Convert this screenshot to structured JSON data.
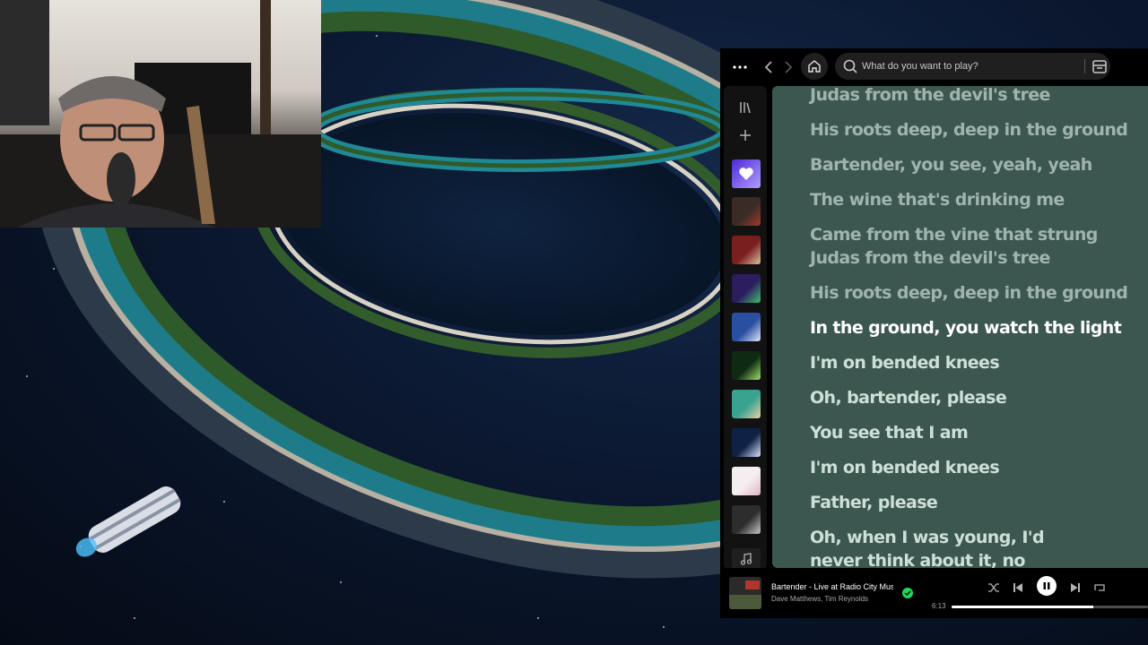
{
  "topbar": {
    "search_placeholder": "What do you want to play?",
    "icons": [
      "more-icon",
      "back-icon",
      "forward-icon",
      "home-icon",
      "search-icon",
      "browse-icon"
    ]
  },
  "sidebar": {
    "icons": [
      "library-icon",
      "plus-icon",
      "heart-icon",
      "music-note-icon"
    ],
    "tiles": [
      {
        "color": "#8a5cf6",
        "color2": "#c9a5ff"
      },
      {
        "color": "#3a2b26",
        "color2": "#a33a2a"
      },
      {
        "color": "#7a1f1f",
        "color2": "#d9c3a0"
      },
      {
        "color": "#2c1d5e",
        "color2": "#3fbf6f"
      },
      {
        "color": "#2b4fa0",
        "color2": "#e0e8f7"
      },
      {
        "color": "#0f2a12",
        "color2": "#9be36a"
      },
      {
        "color": "#3aa38f",
        "color2": "#e8d0a6"
      },
      {
        "color": "#0f2145",
        "color2": "#d7e6ff"
      },
      {
        "color": "#f4eef0",
        "color2": "#e3b4c4"
      },
      {
        "color": "#2d2d2d",
        "color2": "#c8c8c8"
      }
    ]
  },
  "lyrics": {
    "lines": [
      {
        "text": "Judas from the devil's tree",
        "state": "past"
      },
      {
        "text": "His roots deep, deep in the ground",
        "state": "past"
      },
      {
        "text": "Bartender, you see, yeah, yeah",
        "state": "past"
      },
      {
        "text": "The wine that's drinking me",
        "state": "past"
      },
      {
        "text": "Came from the vine that strung",
        "state": "past"
      },
      {
        "text": "Judas from the devil's tree",
        "state": "past"
      },
      {
        "text": "His roots deep, deep in the ground",
        "state": "past"
      },
      {
        "text": "In the ground, you watch the light",
        "state": "active"
      },
      {
        "text": "I'm on bended knees",
        "state": "upcoming"
      },
      {
        "text": "Oh, bartender, please",
        "state": "upcoming"
      },
      {
        "text": "You see that I am",
        "state": "upcoming"
      },
      {
        "text": "I'm on bended knees",
        "state": "upcoming"
      },
      {
        "text": "Father, please",
        "state": "upcoming"
      },
      {
        "text": "Oh, when I was young, I'd",
        "state": "upcoming"
      },
      {
        "text": "never think about it, no",
        "state": "upcoming"
      }
    ],
    "colors": {
      "background": "#3c5750",
      "past": "#9fb4ad",
      "active": "#ffffff",
      "upcoming": "#cde0d8"
    }
  },
  "player": {
    "track_title": "Bartender - Live at Radio City Music Hall",
    "track_artists": "Dave Matthews, Tim Reynolds",
    "saved": true,
    "accent_color": "#1ed760",
    "is_playing": true,
    "elapsed": "6:13",
    "progress": 0.72,
    "icons": [
      "shuffle-icon",
      "previous-icon",
      "pause-icon",
      "next-icon",
      "repeat-icon"
    ]
  }
}
